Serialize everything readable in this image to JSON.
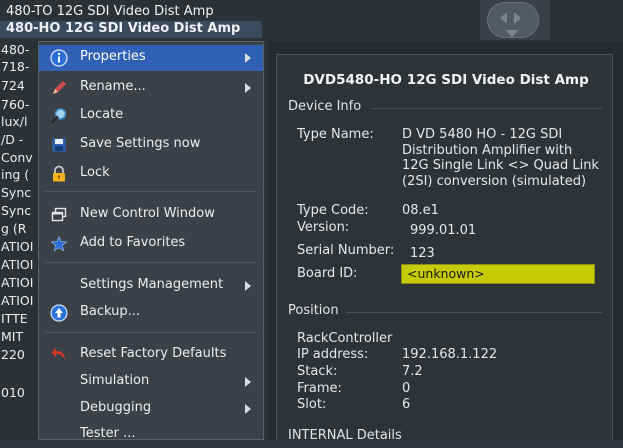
{
  "background_tree": {
    "row1": "480-TO 12G SDI Video Dist Amp",
    "row2": "480-HO 12G SDI Video Dist Amp",
    "stubs": [
      "480-",
      "718-",
      "724",
      "760-",
      "lux/l",
      "/D -",
      "Conv",
      "ing (",
      "Sync",
      "Sync",
      "g (R",
      "ATIOI",
      "ATIOI",
      "ATIOI",
      "ATIOI",
      "ITTE",
      "MIT",
      "220",
      "",
      "010"
    ]
  },
  "context_menu": {
    "items": [
      {
        "label": "Properties",
        "icon": "info-icon",
        "submenu": true,
        "selected": true
      },
      {
        "label": "Rename...",
        "icon": "pencil-icon",
        "submenu": true
      },
      {
        "label": "Locate",
        "icon": "magnifier-icon"
      },
      {
        "label": "Save Settings now",
        "icon": "floppy-disk-icon"
      },
      {
        "label": "Lock",
        "icon": "padlock-icon"
      },
      {
        "label": "New Control Window",
        "icon": "new-window-icon"
      },
      {
        "label": "Add to Favorites",
        "icon": "star-icon"
      },
      {
        "label": "Settings Management",
        "submenu": true
      },
      {
        "label": "Backup...",
        "icon": "backup-icon"
      },
      {
        "label": "Reset Factory Defaults",
        "icon": "reset-arrow-icon"
      },
      {
        "label": "Simulation",
        "submenu": true
      },
      {
        "label": "Debugging",
        "submenu": true
      },
      {
        "label": "Tester ..."
      }
    ]
  },
  "panel": {
    "title": "DVD5480-HO 12G SDI Video Dist Amp",
    "device_info": {
      "header": "Device Info",
      "type_name_label": "Type Name:",
      "type_name_value": "D VD 5480 HO - 12G SDI Distribution Amplifier with 12G Single Link <> Quad Link (2SI) conversion (simulated)",
      "type_code_label": "Type Code:",
      "type_code_value": "08.e1",
      "version_label": "Version:",
      "version_value": "999.01.01",
      "serial_label": "Serial Number:",
      "serial_value": "123",
      "board_label": "Board ID:",
      "board_value": "<unknown>",
      "board_color": "#c7cb06"
    },
    "position": {
      "header": "Position",
      "controller": "RackController",
      "ip_label": "IP address:",
      "ip_value": "192.168.1.122",
      "stack_label": "Stack:",
      "stack_value": "7.2",
      "frame_label": "Frame:",
      "frame_value": "0",
      "slot_label": "Slot:",
      "slot_value": "6"
    },
    "internal": {
      "header": "INTERNAL Details"
    }
  },
  "colors": {
    "menu_selection": "#2f60b5",
    "menu_background": "#3b4146",
    "panel_background": "#2e3337"
  }
}
